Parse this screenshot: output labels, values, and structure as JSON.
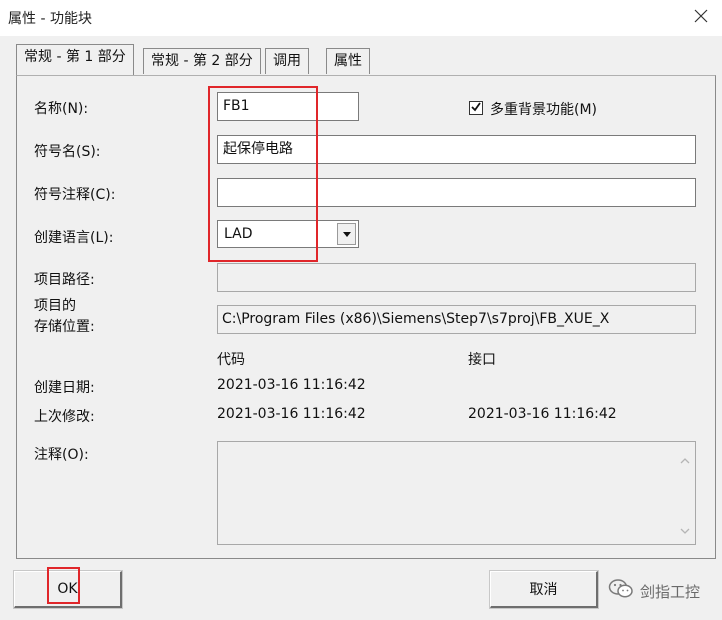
{
  "window": {
    "title": "属性 - 功能块",
    "close_icon": "close-icon"
  },
  "tabs": [
    {
      "label": "常规 - 第 1 部分",
      "active": true
    },
    {
      "label": "常规 - 第 2 部分",
      "active": false
    },
    {
      "label": "调用",
      "active": false
    },
    {
      "label": "属性",
      "active": false
    }
  ],
  "form": {
    "name_label": "名称(N):",
    "name_value": "FB1",
    "multi_instance_label": "多重背景功能(M)",
    "multi_instance_checked": true,
    "symbol_name_label": "符号名(S):",
    "symbol_name_value": "起保停电路",
    "symbol_comment_label": "符号注释(C):",
    "symbol_comment_value": "",
    "language_label": "创建语言(L):",
    "language_value": "LAD",
    "project_path_label": "项目路径:",
    "project_path_value": "",
    "storage_label_line1": "项目的",
    "storage_label_line2": "存储位置:",
    "storage_value": "C:\\Program Files (x86)\\Siemens\\Step7\\s7proj\\FB_XUE_X",
    "col_code": "代码",
    "col_interface": "接口",
    "created_label": "创建日期:",
    "created_code": "2021-03-16 11:16:42",
    "modified_label": "上次修改:",
    "modified_code": "2021-03-16 11:16:42",
    "modified_interface": "2021-03-16 11:16:42",
    "comment_label": "注释(O):",
    "comment_value": ""
  },
  "buttons": {
    "ok": "OK",
    "cancel": "取消"
  },
  "watermark": {
    "text": "剑指工控",
    "icon": "wechat-icon"
  },
  "colors": {
    "highlight": "#e0262a",
    "dialog_bg": "#f0f0f0"
  }
}
